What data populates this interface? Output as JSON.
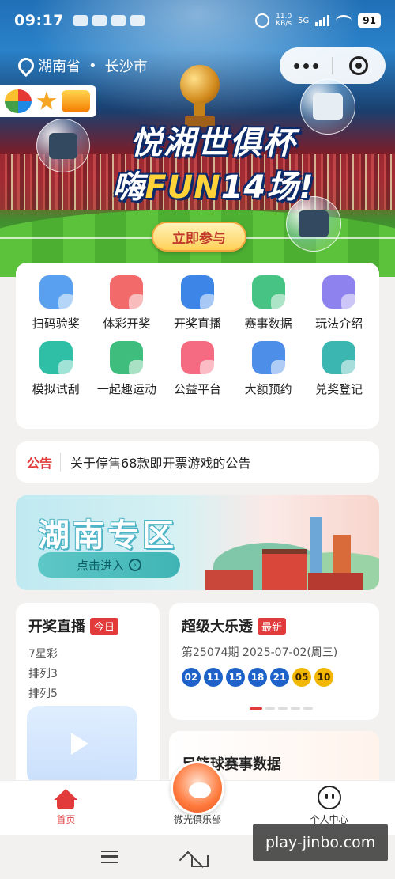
{
  "status_bar": {
    "time": "09:17",
    "network_speed_value": "11.0",
    "network_speed_unit": "KB/s",
    "network_type": "5G",
    "battery": "91"
  },
  "location": {
    "province": "湖南省",
    "separator": "•",
    "city": "长沙市"
  },
  "banner": {
    "title_line1": "悦湘世俱杯",
    "title_line2_prefix": "嗨",
    "title_line2_fun": "FUN",
    "title_line2_suffix": "14场!",
    "join_button": "立即参与"
  },
  "menu": {
    "items": [
      {
        "label": "扫码验奖",
        "icon": "scan-icon",
        "color": "#5aa0f0"
      },
      {
        "label": "体彩开奖",
        "icon": "lottery-draw-icon",
        "color": "#f26a6a"
      },
      {
        "label": "开奖直播",
        "icon": "live-stream-icon",
        "color": "#3d86e8"
      },
      {
        "label": "赛事数据",
        "icon": "chart-icon",
        "color": "#47c483"
      },
      {
        "label": "玩法介绍",
        "icon": "rules-icon",
        "color": "#8e82ee"
      },
      {
        "label": "模拟试刮",
        "icon": "scratch-icon",
        "color": "#2fbfa6"
      },
      {
        "label": "一起趣运动",
        "icon": "sport-icon",
        "color": "#3ebd7d"
      },
      {
        "label": "公益平台",
        "icon": "heart-icon",
        "color": "#f56b82"
      },
      {
        "label": "大额预约",
        "icon": "yuan-icon",
        "color": "#4c8ee8"
      },
      {
        "label": "兑奖登记",
        "icon": "register-icon",
        "color": "#3cb6b0"
      }
    ]
  },
  "notice": {
    "tag": "公告",
    "text": "关于停售68款即开票游戏的公告"
  },
  "zone": {
    "title": "湖南专区",
    "enter": "点击进入"
  },
  "live_card": {
    "title": "开奖直播",
    "badge": "今日",
    "games": [
      "7星彩",
      "排列3",
      "排列5"
    ]
  },
  "lotto_card": {
    "title": "超级大乐透",
    "badge": "最新",
    "issue": "第25074期 2025-07-02(周三)",
    "front_numbers": [
      "02",
      "11",
      "15",
      "18",
      "21"
    ],
    "back_numbers": [
      "05",
      "10"
    ]
  },
  "football_card": {
    "title": "足篮球赛事数据"
  },
  "tabbar": {
    "home": "首页",
    "club": "微光俱乐部",
    "profile": "个人中心"
  },
  "watermark": "play-jinbo.com"
}
